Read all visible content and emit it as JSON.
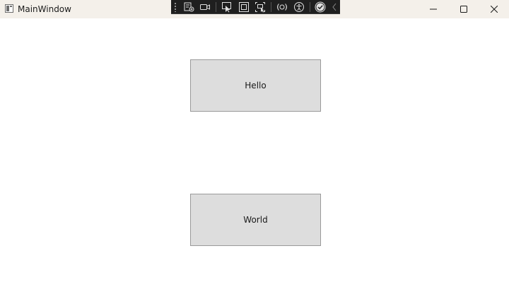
{
  "window": {
    "title": "MainWindow",
    "controls": {
      "minimize_icon": "minimize-icon",
      "maximize_icon": "maximize-icon",
      "close_icon": "close-icon"
    }
  },
  "debug_toolbar": {
    "icons": [
      "live-visual-tree-icon",
      "record-icon",
      "select-element-icon",
      "display-layout-adorners-icon",
      "track-focus-icon",
      "hot-reload-icon",
      "accessibility-icon",
      "accessibility-checker-icon",
      "collapse-chevron-icon"
    ],
    "background": "#1f1f1f"
  },
  "content": {
    "buttons": [
      {
        "label": "Hello"
      },
      {
        "label": "World"
      }
    ],
    "button_color": "#dddddd",
    "button_border": "#9a9a9a"
  }
}
